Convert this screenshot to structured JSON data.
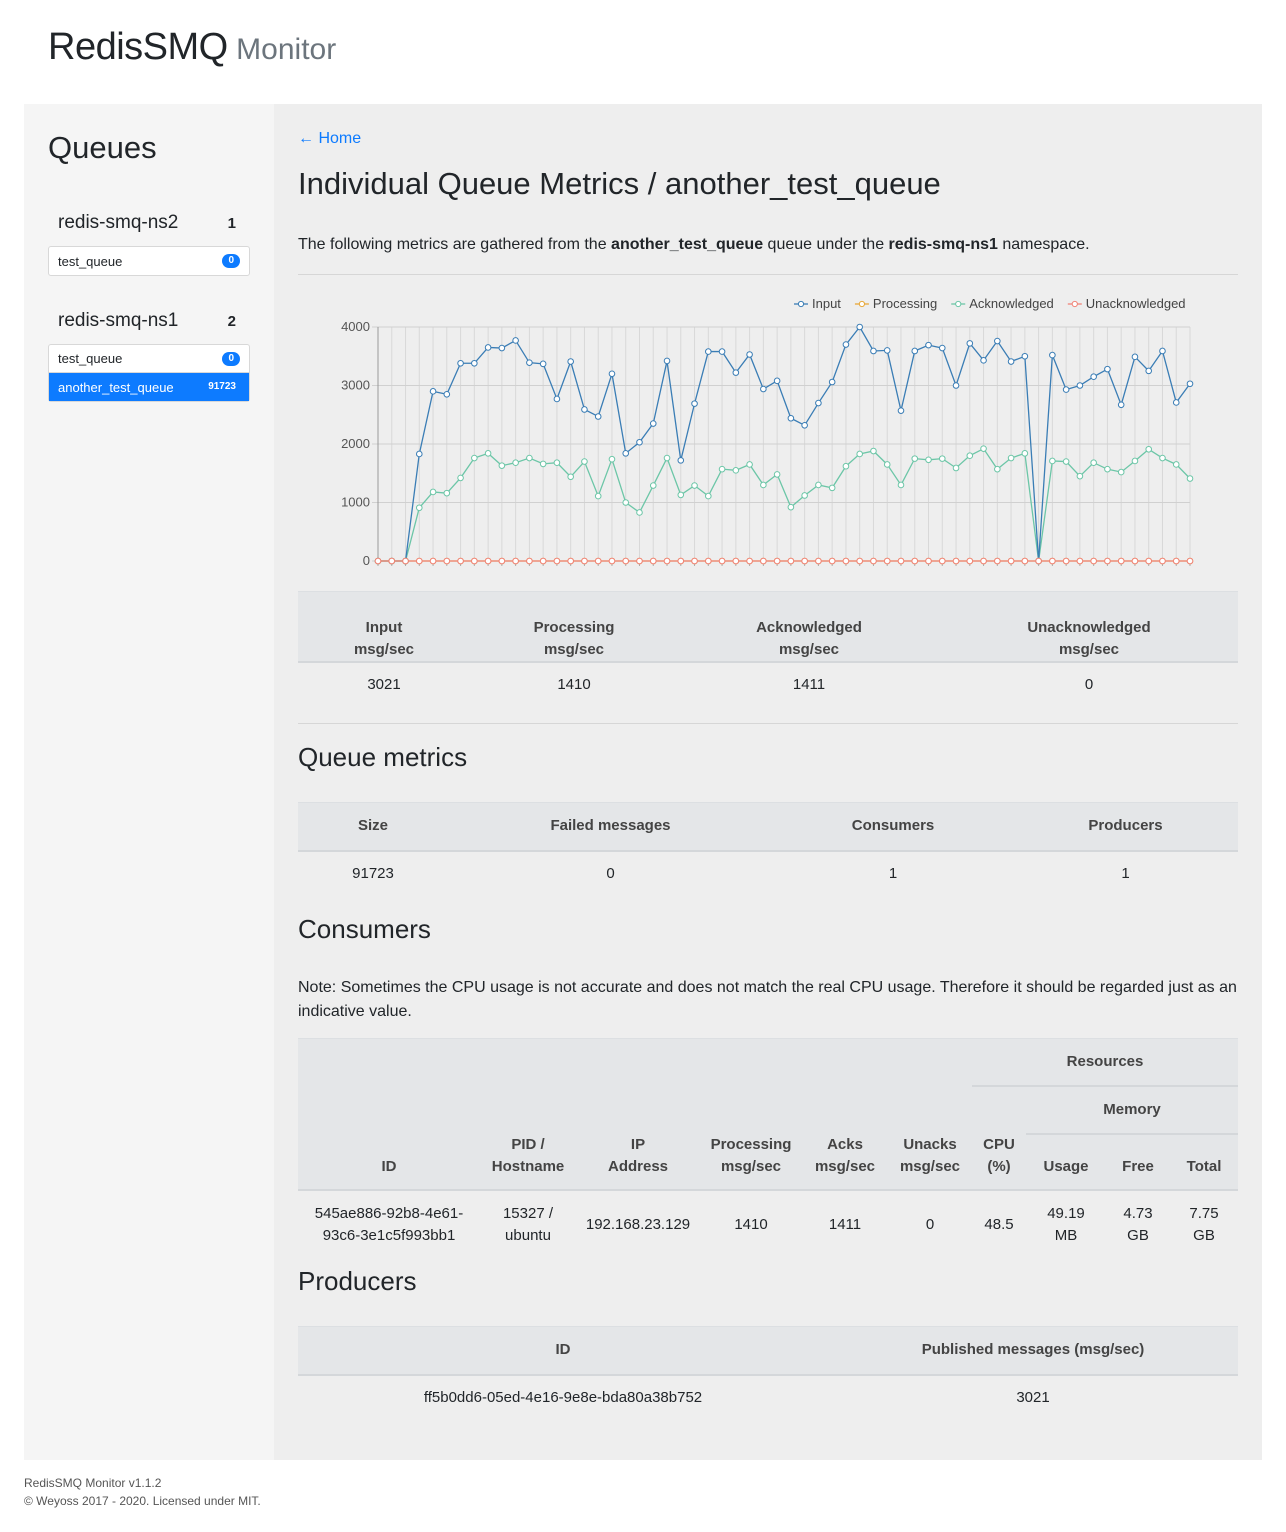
{
  "app": {
    "name": "RedisSMQ",
    "subtitle": "Monitor"
  },
  "sidebar": {
    "title": "Queues",
    "namespaces": [
      {
        "name": "redis-smq-ns2",
        "count": "1",
        "queues": [
          {
            "name": "test_queue",
            "badge": "0"
          }
        ]
      },
      {
        "name": "redis-smq-ns1",
        "count": "2",
        "queues": [
          {
            "name": "test_queue",
            "badge": "0"
          },
          {
            "name": "another_test_queue",
            "badge": "91723"
          }
        ]
      }
    ]
  },
  "main": {
    "home_link": "← Home",
    "title": "Individual Queue Metrics / another_test_queue",
    "desc_prefix": "The following metrics are gathered from the",
    "desc_queue": "another_test_queue",
    "desc_middle": "queue under the",
    "desc_namespace": "redis-smq-ns1",
    "desc_suffix": "namespace."
  },
  "rates_table": {
    "headers": [
      [
        "Input",
        "msg/sec"
      ],
      [
        "Processing",
        "msg/sec"
      ],
      [
        "Acknowledged",
        "msg/sec"
      ],
      [
        "Unacknowledged",
        "msg/sec"
      ]
    ],
    "values": [
      "3021",
      "1410",
      "1411",
      "0"
    ]
  },
  "queue_metrics": {
    "title": "Queue metrics",
    "headers": [
      "Size",
      "Failed messages",
      "Consumers",
      "Producers"
    ],
    "values": [
      "91723",
      "0",
      "1",
      "1"
    ]
  },
  "consumers": {
    "title": "Consumers",
    "note": "Note: Sometimes the CPU usage is not accurate and does not match the real CPU usage. Therefore it should be regarded just as an indicative value.",
    "group_resources": "Resources",
    "group_memory": "Memory",
    "headers": [
      [
        "ID"
      ],
      [
        "PID /",
        "Hostname"
      ],
      [
        "IP",
        "Address"
      ],
      [
        "Processing",
        "msg/sec"
      ],
      [
        "Acks",
        "msg/sec"
      ],
      [
        "Unacks",
        "msg/sec"
      ],
      [
        "CPU",
        "(%)"
      ],
      [
        "Usage"
      ],
      [
        "Free"
      ],
      [
        "Total"
      ]
    ],
    "row": [
      [
        "545ae886-92b8-4e61-",
        "93c6-3e1c5f993bb1"
      ],
      [
        "15327 /",
        "ubuntu"
      ],
      [
        "192.168.23.129"
      ],
      [
        "1410"
      ],
      [
        "1411"
      ],
      [
        "0"
      ],
      [
        "48.5"
      ],
      [
        "49.19",
        "MB"
      ],
      [
        "4.73",
        "GB"
      ],
      [
        "7.75",
        "GB"
      ]
    ]
  },
  "producers": {
    "title": "Producers",
    "headers": [
      "ID",
      "Published messages (msg/sec)"
    ],
    "row": [
      "ff5b0dd6-05ed-4e16-9e8e-bda80a38b752",
      "3021"
    ]
  },
  "footer": {
    "line1": "RedisSMQ Monitor v1.1.2",
    "line2": "© Weyoss 2017 - 2020. Licensed under MIT."
  },
  "chart_data": {
    "type": "line",
    "ylim": [
      0,
      4000
    ],
    "yticks": [
      0,
      1000,
      2000,
      3000,
      4000
    ],
    "grid": true,
    "legend_position": "top-right",
    "series": [
      {
        "name": "Input",
        "color": "#3a7db5",
        "values": [
          0,
          0,
          0,
          1830,
          2900,
          2850,
          3380,
          3380,
          3650,
          3640,
          3770,
          3390,
          3370,
          2770,
          3410,
          2590,
          2470,
          3200,
          1840,
          2030,
          2350,
          3420,
          1720,
          2690,
          3580,
          3580,
          3220,
          3530,
          2940,
          3080,
          2440,
          2320,
          2700,
          3060,
          3700,
          4000,
          3590,
          3600,
          2570,
          3590,
          3690,
          3640,
          3000,
          3720,
          3430,
          3760,
          3410,
          3500,
          0,
          3520,
          2930,
          3000,
          3150,
          3280,
          2670,
          3490,
          3250,
          3590,
          2710,
          3030
        ]
      },
      {
        "name": "Processing",
        "color": "#e8a838",
        "values": [
          0,
          0,
          0,
          0,
          0,
          0,
          0,
          0,
          0,
          0,
          0,
          0,
          0,
          0,
          0,
          0,
          0,
          0,
          0,
          0,
          0,
          0,
          0,
          0,
          0,
          0,
          0,
          0,
          0,
          0,
          0,
          0,
          0,
          0,
          0,
          0,
          0,
          0,
          0,
          0,
          0,
          0,
          0,
          0,
          0,
          0,
          0,
          0,
          0,
          0,
          0,
          0,
          0,
          0,
          0,
          0,
          0,
          0,
          0,
          0
        ]
      },
      {
        "name": "Acknowledged",
        "color": "#6cc6a7",
        "values": [
          0,
          0,
          0,
          910,
          1180,
          1160,
          1420,
          1760,
          1840,
          1630,
          1680,
          1760,
          1660,
          1680,
          1440,
          1700,
          1110,
          1740,
          1000,
          830,
          1290,
          1760,
          1130,
          1290,
          1110,
          1570,
          1550,
          1650,
          1300,
          1480,
          920,
          1120,
          1300,
          1250,
          1620,
          1830,
          1880,
          1650,
          1300,
          1750,
          1730,
          1750,
          1590,
          1800,
          1920,
          1570,
          1760,
          1840,
          0,
          1710,
          1700,
          1450,
          1680,
          1570,
          1520,
          1710,
          1910,
          1760,
          1650,
          1410
        ]
      },
      {
        "name": "Unacknowledged",
        "color": "#f08478",
        "values": [
          0,
          0,
          0,
          0,
          0,
          0,
          0,
          0,
          0,
          0,
          0,
          0,
          0,
          0,
          0,
          0,
          0,
          0,
          0,
          0,
          0,
          0,
          0,
          0,
          0,
          0,
          0,
          0,
          0,
          0,
          0,
          0,
          0,
          0,
          0,
          0,
          0,
          0,
          0,
          0,
          0,
          0,
          0,
          0,
          0,
          0,
          0,
          0,
          0,
          0,
          0,
          0,
          0,
          0,
          0,
          0,
          0,
          0,
          0,
          0
        ]
      }
    ]
  }
}
